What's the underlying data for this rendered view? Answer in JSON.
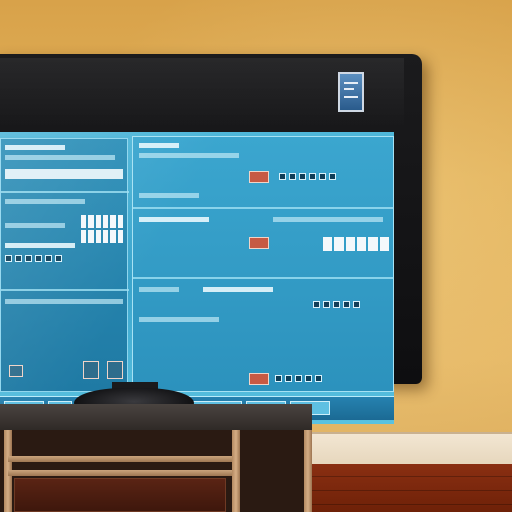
{
  "scene": {
    "description_tags": [
      "tv-on-wall",
      "desktop-ui-on-screen",
      "media-cabinet"
    ],
    "wall_color": "#e3b35b",
    "screen_color": "#4fb7d9",
    "bezel_color": "#111113",
    "floor_color": "#7a2a0e"
  }
}
